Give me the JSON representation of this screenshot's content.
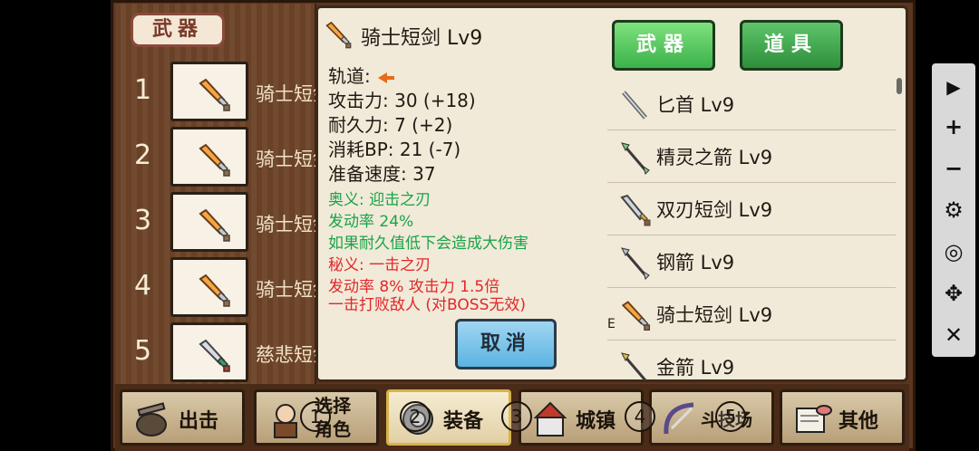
{
  "left_panel": {
    "category_tag": "武器",
    "slots": [
      {
        "num": "1",
        "name": "骑士短剑"
      },
      {
        "num": "2",
        "name": "骑士短剑"
      },
      {
        "num": "3",
        "name": "骑士短剑"
      },
      {
        "num": "4",
        "name": "骑士短剑"
      },
      {
        "num": "5",
        "name": "慈悲短剑"
      }
    ]
  },
  "detail": {
    "title": "骑士短剑 Lv9",
    "track_label": "轨道:",
    "attack": "攻击力: 30 (+18)",
    "durability": "耐久力: 7 (+2)",
    "bp_cost": "消耗BP: 21 (-7)",
    "speed": "准备速度: 37",
    "skill1_title": "奥义: 迎击之刃",
    "skill1_rate": "发动率 24%",
    "skill1_desc": "如果耐久值低下会造成大伤害",
    "skill2_title": "秘义: 一击之刃",
    "skill2_rate": "发动率 8%    攻击力 1.5倍",
    "skill2_desc": "一击打败敌人 (对BOSS无效)",
    "cancel_label": "取消"
  },
  "tabs": {
    "weapons_label": "武器",
    "items_label": "道具"
  },
  "item_list": [
    {
      "name": "匕首 Lv9",
      "icon": "dagger-icon",
      "mark": ""
    },
    {
      "name": "精灵之箭 Lv9",
      "icon": "elf-arrow-icon",
      "mark": ""
    },
    {
      "name": "双刃短剑 Lv9",
      "icon": "double-blade-icon",
      "mark": ""
    },
    {
      "name": "钢箭 Lv9",
      "icon": "steel-arrow-icon",
      "mark": ""
    },
    {
      "name": "骑士短剑 Lv9",
      "icon": "knight-sword-icon",
      "mark": "E"
    },
    {
      "name": "金箭 Lv9",
      "icon": "gold-arrow-icon",
      "mark": ""
    }
  ],
  "bottom_nav": [
    {
      "label": "出击",
      "num": ""
    },
    {
      "label_line1": "选择",
      "label_line2": "角色",
      "num": "1"
    },
    {
      "label": "装备",
      "num": "2"
    },
    {
      "label": "城镇",
      "num": "3"
    },
    {
      "label": "斗技场",
      "num": "4"
    },
    {
      "label": "其他",
      "num": "5"
    }
  ],
  "toolbar": {
    "play": "▶",
    "plus": "+",
    "minus": "−",
    "settings": "⚙",
    "hide": "◎",
    "move": "✥",
    "close": "✕"
  },
  "colors": {
    "sword_blade": "#f0a040",
    "green_text": "#1aa34a",
    "red_text": "#e2272a",
    "tab_green": "#3cb24a",
    "cancel_blue": "#5cb3e2"
  }
}
